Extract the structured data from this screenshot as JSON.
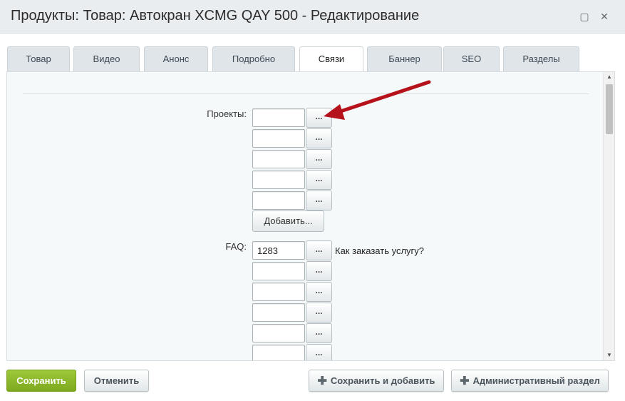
{
  "window": {
    "title": "Продукты: Товар: Автокран XCMG QAY 500 - Редактирование",
    "maximize_glyph": "▢",
    "close_glyph": "✕"
  },
  "tabs": [
    {
      "label": "Товар"
    },
    {
      "label": "Видео"
    },
    {
      "label": "Анонс"
    },
    {
      "label": "Подробно"
    },
    {
      "label": "Связи",
      "active": true
    },
    {
      "label": "Баннер"
    },
    {
      "label": "SEO"
    },
    {
      "label": "Разделы"
    }
  ],
  "form": {
    "projects": {
      "label": "Проекты:",
      "values": [
        "",
        "",
        "",
        "",
        ""
      ],
      "pick_label": "...",
      "add_label": "Добавить..."
    },
    "faq": {
      "label": "FAQ:",
      "values": [
        "1283",
        "",
        "",
        "",
        "",
        ""
      ],
      "pick_label": "...",
      "linked_name": "Как заказать услугу?"
    }
  },
  "scrollbar": {
    "up_glyph": "▲",
    "down_glyph": "▼"
  },
  "footer": {
    "save": "Сохранить",
    "cancel": "Отменить",
    "save_and_add": "Сохранить и добавить",
    "admin_section": "Административный раздел",
    "plus_glyph": "✚"
  },
  "colors": {
    "annotation_arrow": "#b5121b",
    "save_button": "#8ab82c"
  }
}
